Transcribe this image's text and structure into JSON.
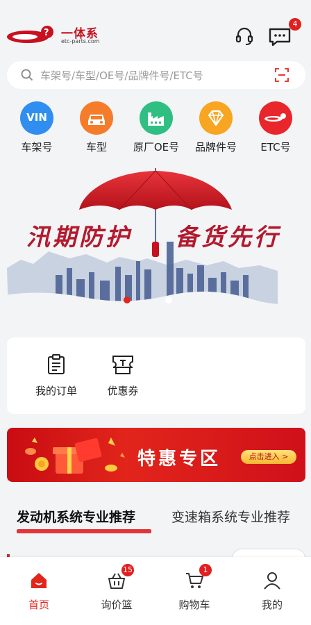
{
  "header": {
    "logo_text": "一体系",
    "logo_subtext": "etc-parts.com",
    "message_badge": "4"
  },
  "search": {
    "placeholder": "车架号/车型/OE号/品牌件号/ETC号"
  },
  "categories": [
    {
      "label": "车架号",
      "icon": "vin-icon",
      "icon_text": "VIN",
      "color": "#2f8ef0"
    },
    {
      "label": "车型",
      "icon": "car-icon",
      "color": "#f57c2a"
    },
    {
      "label": "原厂OE号",
      "icon": "factory-icon",
      "color": "#2fbf83"
    },
    {
      "label": "品牌件号",
      "icon": "diamond-icon",
      "color": "#f8a521"
    },
    {
      "label": "ETC号",
      "icon": "etc-logo-icon",
      "color": "#e8262b"
    }
  ],
  "banner": {
    "text_left": "汛期防护",
    "text_right": "备货先行"
  },
  "quick": [
    {
      "label": "我的订单",
      "icon": "order-icon"
    },
    {
      "label": "优惠券",
      "icon": "coupon-icon"
    }
  ],
  "promo": {
    "title": "特惠专区",
    "button": "点击进入 >"
  },
  "tabs": {
    "active": "发动机系统专业推荐",
    "inactive": "变速箱系统专业推荐"
  },
  "tabbar": [
    {
      "label": "首页",
      "icon": "home-icon",
      "active": true
    },
    {
      "label": "询价篮",
      "icon": "basket-icon",
      "badge": "15"
    },
    {
      "label": "购物车",
      "icon": "cart-icon",
      "badge": "1"
    },
    {
      "label": "我的",
      "icon": "user-icon"
    }
  ],
  "colors": {
    "brand_red": "#e1251b",
    "background": "#f3f4f6"
  }
}
